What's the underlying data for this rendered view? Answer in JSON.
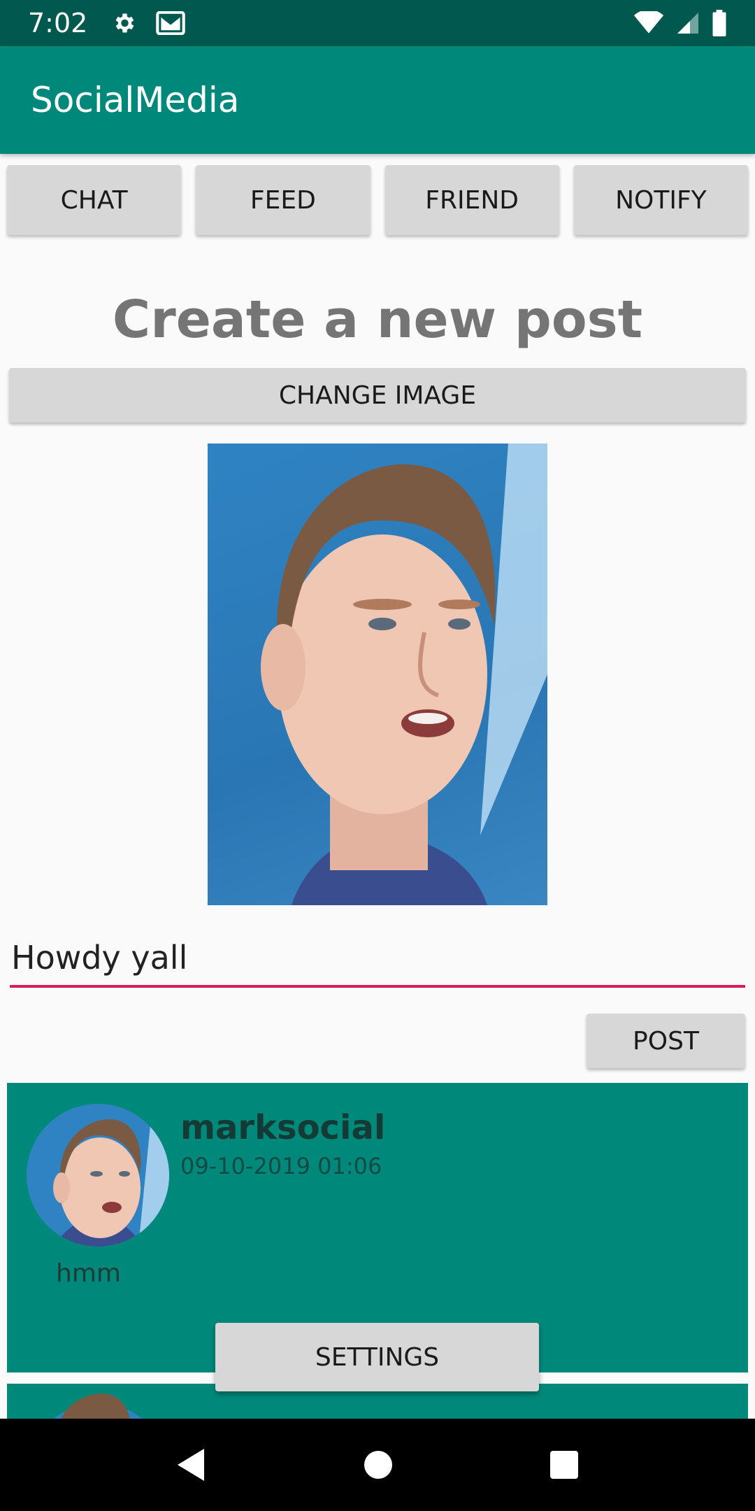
{
  "status_bar": {
    "time": "7:02",
    "icons": [
      "settings-icon",
      "gmail-icon",
      "wifi-icon",
      "signal-icon",
      "battery-icon"
    ]
  },
  "app_bar": {
    "title": "SocialMedia"
  },
  "nav": {
    "tabs": [
      {
        "label": "CHAT"
      },
      {
        "label": "FEED"
      },
      {
        "label": "FRIEND"
      },
      {
        "label": "NOTIFY"
      }
    ]
  },
  "create_post": {
    "heading": "Create a new post",
    "change_image_label": "CHANGE IMAGE",
    "caption_value": "Howdy yall",
    "post_label": "POST"
  },
  "feed": {
    "posts": [
      {
        "username": "marksocial",
        "timestamp": "09-10-2019 01:06",
        "body": "hmm"
      }
    ]
  },
  "settings_label": "SETTINGS",
  "colors": {
    "primary": "#00897b",
    "primary_dark": "#00584e",
    "accent": "#d81b60",
    "button": "#d7d7d7"
  }
}
